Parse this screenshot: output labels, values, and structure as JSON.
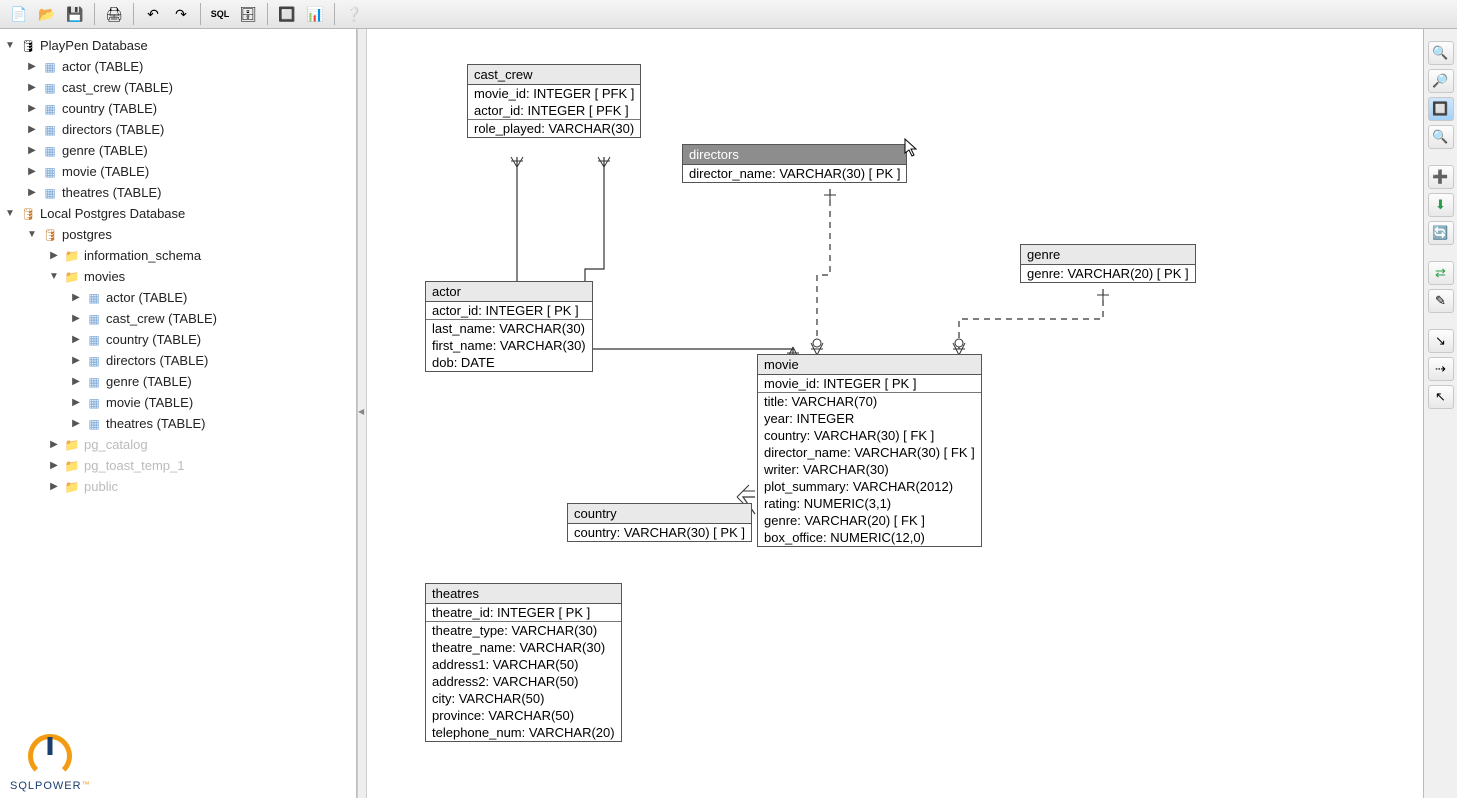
{
  "toolbar": {
    "buttons": [
      "new",
      "open",
      "save",
      "print",
      "undo",
      "redo",
      "sql",
      "ddl",
      "layout",
      "report",
      "help"
    ]
  },
  "tree": {
    "root1": {
      "label": "PlayPen Database"
    },
    "root1_children": [
      {
        "label": "actor (TABLE)"
      },
      {
        "label": "cast_crew (TABLE)"
      },
      {
        "label": "country (TABLE)"
      },
      {
        "label": "directors (TABLE)"
      },
      {
        "label": "genre (TABLE)"
      },
      {
        "label": "movie (TABLE)"
      },
      {
        "label": "theatres (TABLE)"
      }
    ],
    "root2": {
      "label": "Local Postgres Database"
    },
    "postgres": {
      "label": "postgres"
    },
    "info_schema": {
      "label": "information_schema"
    },
    "movies_schema": {
      "label": "movies"
    },
    "movies_children": [
      {
        "label": "actor (TABLE)"
      },
      {
        "label": "cast_crew (TABLE)"
      },
      {
        "label": "country (TABLE)"
      },
      {
        "label": "directors (TABLE)"
      },
      {
        "label": "genre (TABLE)"
      },
      {
        "label": "movie (TABLE)"
      },
      {
        "label": "theatres (TABLE)"
      }
    ],
    "pg_catalog": {
      "label": "pg_catalog"
    },
    "pg_toast": {
      "label": "pg_toast_temp_1"
    },
    "public": {
      "label": "public"
    }
  },
  "erd": {
    "cast_crew": {
      "title": "cast_crew",
      "pk": [
        "movie_id: INTEGER  [ PFK ]",
        "actor_id: INTEGER  [ PFK ]"
      ],
      "cols": [
        "role_played: VARCHAR(30)"
      ]
    },
    "directors": {
      "title": "directors",
      "pk": [
        "director_name: VARCHAR(30)  [ PK ]"
      ]
    },
    "actor": {
      "title": "actor",
      "pk": [
        "actor_id: INTEGER  [ PK ]"
      ],
      "cols": [
        "last_name: VARCHAR(30)",
        "first_name: VARCHAR(30)",
        "dob: DATE"
      ]
    },
    "genre": {
      "title": "genre",
      "pk": [
        "genre: VARCHAR(20)  [ PK ]"
      ]
    },
    "movie": {
      "title": "movie",
      "pk": [
        "movie_id: INTEGER  [ PK ]"
      ],
      "cols": [
        "title: VARCHAR(70)",
        "year: INTEGER",
        "country: VARCHAR(30)  [ FK ]",
        "director_name: VARCHAR(30)  [ FK ]",
        "writer: VARCHAR(30)",
        "plot_summary: VARCHAR(2012)",
        "rating: NUMERIC(3,1)",
        "genre: VARCHAR(20)  [ FK ]",
        "box_office: NUMERIC(12,0)"
      ]
    },
    "country": {
      "title": "country",
      "pk": [
        "country: VARCHAR(30)  [ PK ]"
      ]
    },
    "theatres": {
      "title": "theatres",
      "pk": [
        "theatre_id: INTEGER  [ PK ]"
      ],
      "cols": [
        "theatre_type: VARCHAR(30)",
        "theatre_name: VARCHAR(30)",
        "address1: VARCHAR(50)",
        "address2: VARCHAR(50)",
        "city: VARCHAR(50)",
        "province: VARCHAR(50)",
        "telephone_num: VARCHAR(20)"
      ]
    }
  },
  "logo": {
    "text": "SQLPOWER",
    "tm": "™"
  }
}
